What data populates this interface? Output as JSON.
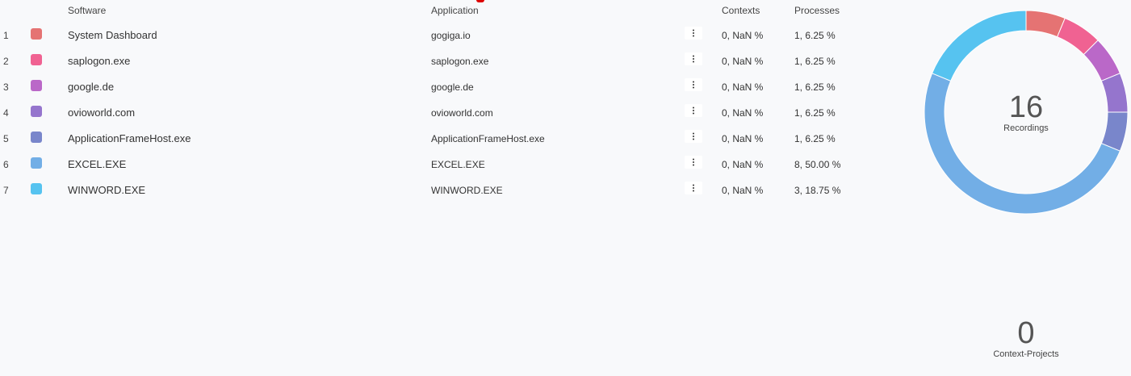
{
  "table": {
    "headers": {
      "software": "Software",
      "application": "Application",
      "contexts": "Contexts",
      "processes": "Processes"
    },
    "rows": [
      {
        "index": "1",
        "color": "#e57373",
        "software": "System Dashboard",
        "application": "gogiga.io",
        "contexts": "0, NaN %",
        "processes": "1, 6.25 %"
      },
      {
        "index": "2",
        "color": "#f06292",
        "software": "saplogon.exe",
        "application": "saplogon.exe",
        "contexts": "0, NaN %",
        "processes": "1, 6.25 %"
      },
      {
        "index": "3",
        "color": "#ba68c8",
        "software": "google.de",
        "application": "google.de",
        "contexts": "0, NaN %",
        "processes": "1, 6.25 %"
      },
      {
        "index": "4",
        "color": "#9575cd",
        "software": "ovioworld.com",
        "application": "ovioworld.com",
        "contexts": "0, NaN %",
        "processes": "1, 6.25 %"
      },
      {
        "index": "5",
        "color": "#7986cb",
        "software": "ApplicationFrameHost.exe",
        "application": "ApplicationFrameHost.exe",
        "contexts": "0, NaN %",
        "processes": "1, 6.25 %"
      },
      {
        "index": "6",
        "color": "#72aee6",
        "software": "EXCEL.EXE",
        "application": "EXCEL.EXE",
        "contexts": "0, NaN %",
        "processes": "8, 50.00 %"
      },
      {
        "index": "7",
        "color": "#56c3f0",
        "software": "WINWORD.EXE",
        "application": "WINWORD.EXE",
        "contexts": "0, NaN %",
        "processes": "3, 18.75 %"
      }
    ],
    "menu_icon": "more-vertical-icon"
  },
  "recordings": {
    "count": "16",
    "label": "Recordings"
  },
  "context_projects": {
    "count": "0",
    "label": "Context-Projects"
  },
  "chart_data": {
    "type": "pie",
    "categories": [
      "System Dashboard",
      "saplogon.exe",
      "google.de",
      "ovioworld.com",
      "ApplicationFrameHost.exe",
      "EXCEL.EXE",
      "WINWORD.EXE"
    ],
    "values": [
      1,
      1,
      1,
      1,
      1,
      8,
      3
    ],
    "colors": [
      "#e57373",
      "#f06292",
      "#ba68c8",
      "#9575cd",
      "#7986cb",
      "#72aee6",
      "#56c3f0"
    ],
    "donut": true
  }
}
